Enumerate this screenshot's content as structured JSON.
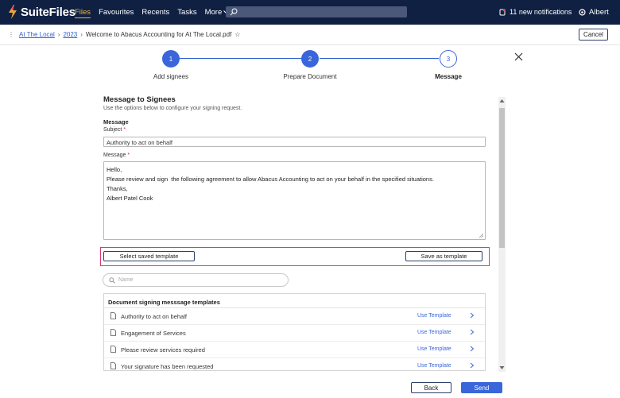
{
  "app": {
    "name": "SuiteFiles"
  },
  "nav": {
    "items": [
      "Files",
      "Favourites",
      "Recents",
      "Tasks",
      "More"
    ]
  },
  "header": {
    "notifications": "11 new notifications",
    "user": "Albert"
  },
  "breadcrumb": {
    "items": [
      "At The Local",
      "2023"
    ],
    "current": "Welcome to Abacus Accounting for At The Local.pdf",
    "cancel_label": "Cancel"
  },
  "stepper": {
    "steps": [
      {
        "number": "1",
        "label": "Add signees"
      },
      {
        "number": "2",
        "label": "Prepare Document"
      },
      {
        "number": "3",
        "label": "Message"
      }
    ],
    "current_step": 3
  },
  "form": {
    "title": "Message to Signees",
    "subtitle": "Use the options below to configure your signing request.",
    "section_heading": "Message",
    "subject_label": "Subject",
    "subject_value": "Authority to act on behalf",
    "message_label": "Message",
    "message_lines": [
      "Hello,",
      "",
      "Please review and sign  the following agreement to allow Abacus Accounting to act on your behalf in the specified situations.",
      "",
      "Thanks,",
      "Albert Patel Cook"
    ],
    "select_template_label": "Select saved template",
    "save_template_label": "Save as template"
  },
  "templates": {
    "search_placeholder": "Name",
    "heading": "Document signing messsage templates",
    "use_label": "Use Template",
    "items": [
      "Authority to act on behalf",
      "Engagement of Services",
      "Please review services required",
      "Your signature has been requested"
    ]
  },
  "footer": {
    "back_label": "Back",
    "send_label": "Send"
  },
  "colors": {
    "accent": "#3a66db",
    "topbar": "#0f2043",
    "highlight": "#d93a73",
    "active_nav": "#f5b13d"
  }
}
